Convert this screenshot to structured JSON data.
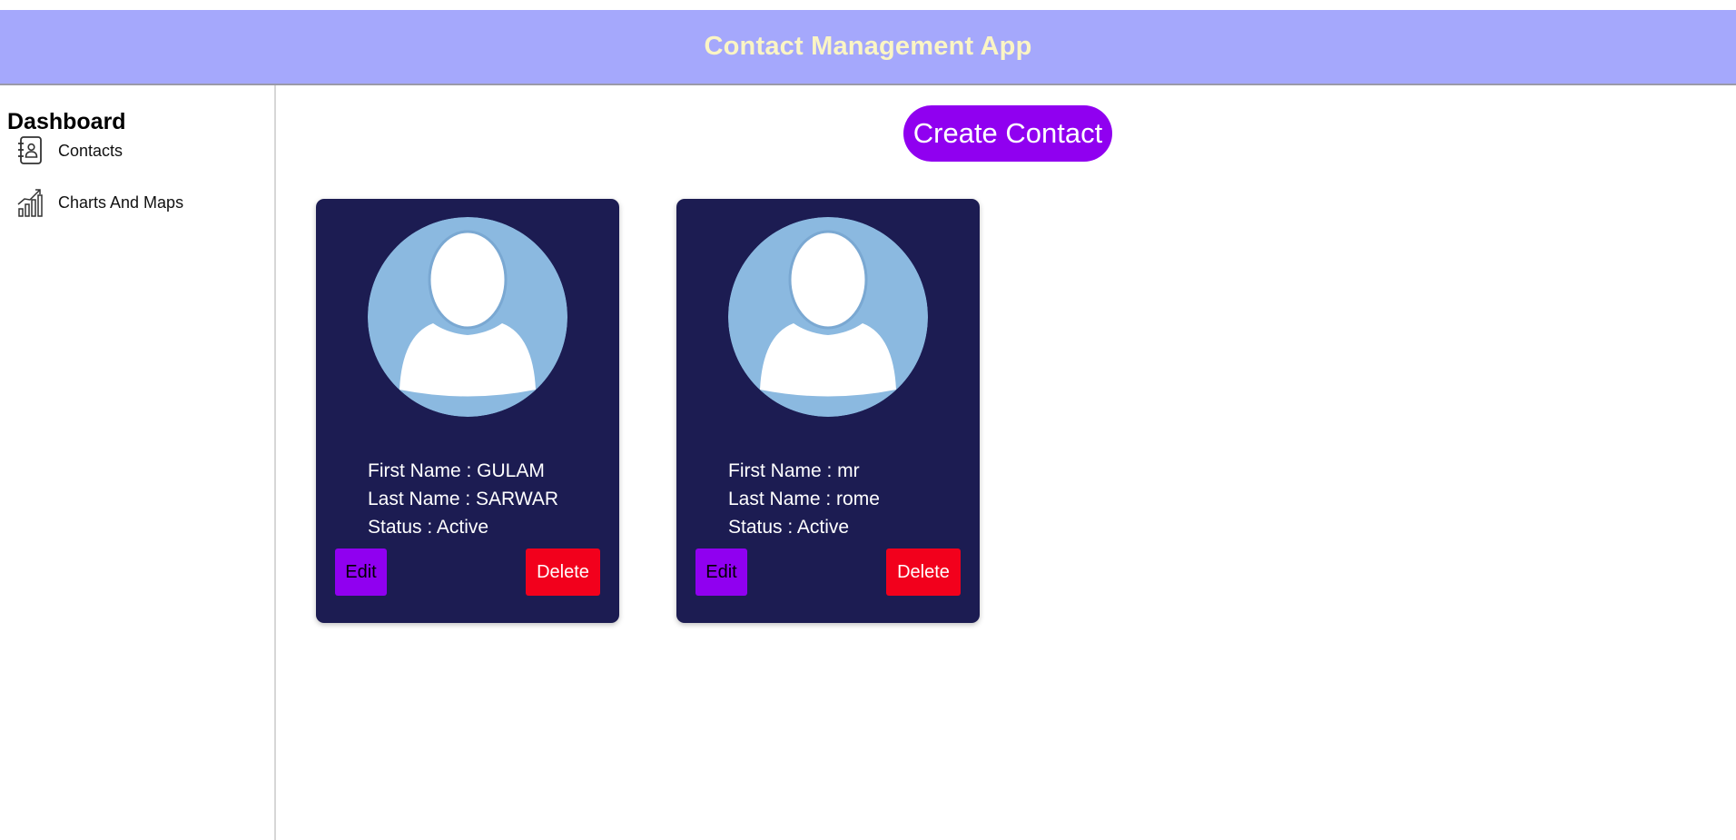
{
  "app": {
    "title": "Contact Management App"
  },
  "sidebar": {
    "title": "Dashboard",
    "items": [
      {
        "label": "Contacts",
        "icon": "contacts-book-icon"
      },
      {
        "label": "Charts And Maps",
        "icon": "chart-growth-icon"
      }
    ]
  },
  "main": {
    "create_label": "Create Contact",
    "contacts": [
      {
        "first_name_line": "First Name : GULAM",
        "last_name_line": "Last Name : SARWAR",
        "status_line": "Status : Active",
        "edit_label": "Edit",
        "delete_label": "Delete",
        "avatar_icon": "default-avatar-icon"
      },
      {
        "first_name_line": "First Name : mr",
        "last_name_line": "Last Name : rome",
        "status_line": "Status : Active",
        "edit_label": "Edit",
        "delete_label": "Delete",
        "avatar_icon": "default-avatar-icon"
      }
    ]
  },
  "colors": {
    "header_bg": "#a5a8fc",
    "header_text": "#fbf5c4",
    "card_bg": "#1c1c52",
    "primary_button": "#9000f0",
    "danger_button": "#f2001c",
    "avatar_bg": "#8bb9e0"
  }
}
